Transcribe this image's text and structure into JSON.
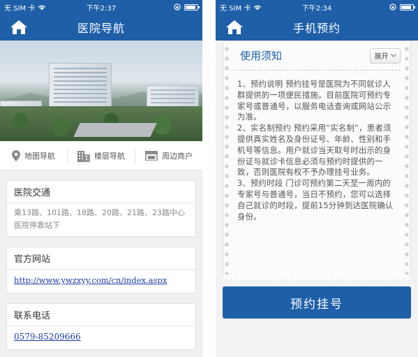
{
  "left": {
    "status": {
      "carrier": "无 SIM 卡",
      "time": "下午2:37",
      "battery_percent": 90
    },
    "nav": {
      "title": "医院导航"
    },
    "hero": {
      "image": "hospital-aerial-photo"
    },
    "tabs": [
      {
        "label": "地图导航",
        "icon": "map-pin-icon"
      },
      {
        "label": "楼层导航",
        "icon": "building-icon"
      },
      {
        "label": "周边商户",
        "icon": "shop-icon"
      }
    ],
    "traffic": {
      "title": "医院交通",
      "text": "乘13路、101路、18路、20路、21路、23路中心医院停靠站下"
    },
    "website": {
      "title": "官方网站",
      "url": "http://www.ywzxyy.com/cn/index.aspx"
    },
    "phone": {
      "title": "联系电话",
      "number": "0579-85209666"
    }
  },
  "right": {
    "status": {
      "carrier": "无 SIM 卡",
      "time": "下午2:34",
      "battery_percent": 90
    },
    "nav": {
      "title": "手机预约"
    },
    "notice": {
      "title": "使用须知",
      "expand_label": "展开",
      "text": "1、预约说明 预约挂号是医院为不同就诊人群提供的一项便民措施。目前医院可预约专家号或普通号，以服务电话查询或网站公示为准。\n2、实名制预约 预约采用“实名制”，患者须提供真实姓名及身份证号、年龄、性别和手机号等信息。用户就诊当天取号时出示的身份证与就诊卡信息必须与预约时提供的一致，否则医院有权不予办理挂号业务。\n3、预约时段 门诊可预约第二天至一周内的专家号与普通号，当日不预约，您可以选择自己就诊的时段，提前15分钟到达医院确认身份。"
    },
    "book_button": "预约挂号"
  }
}
